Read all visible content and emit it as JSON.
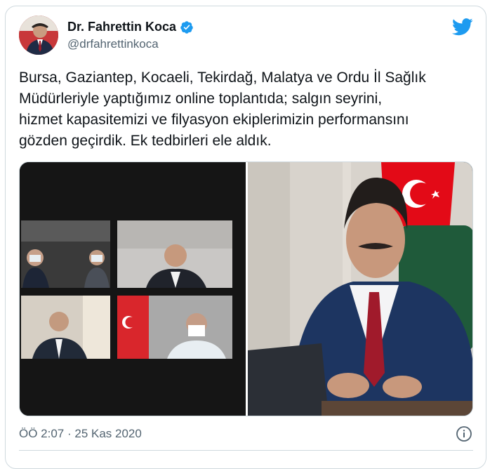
{
  "author": {
    "display_name": "Dr. Fahrettin Koca",
    "handle": "@drfahrettinkoca",
    "verified_icon": "verified-badge-icon",
    "avatar_icon": "avatar"
  },
  "tweet": {
    "text": "Bursa, Gaziantep, Kocaeli, Tekirdağ, Malatya ve Ordu İl Sağlık\nMüdürleriyle yaptığımız online toplantıda; salgın seyrini,\nhizmet kapasitemizi ve filyasyon ekiplerimizin performansını\ngözden geçirdik. Ek tedbirleri ele aldık.",
    "timestamp": "ÖÖ 2:07 · 25 Kas 2020"
  },
  "colors": {
    "twitter_blue": "#1d9bf0",
    "text_primary": "#0f1419",
    "text_secondary": "#536471",
    "border": "#cfd9de",
    "flag_red": "#e30a17"
  },
  "icons": {
    "brand": "twitter-bird-icon",
    "info": "info-icon"
  }
}
